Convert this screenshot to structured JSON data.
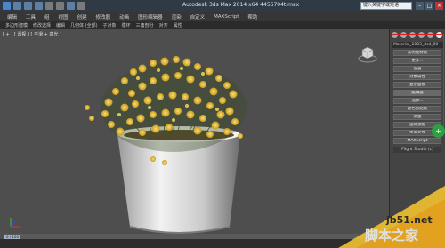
{
  "window": {
    "title": "Autodesk 3ds Max 2014 x64    4456704t.max",
    "search_placeholder": "键入关键字或短语"
  },
  "menubar": {
    "items": [
      "编辑",
      "工具",
      "组",
      "视图",
      "创建",
      "修改器",
      "动画",
      "图形编辑器",
      "渲染",
      "自定义",
      "MAXScript",
      "帮助"
    ]
  },
  "ribbon": {
    "tabs": [
      "建模",
      "自由形式",
      "选择",
      "对象绘制",
      "填充"
    ],
    "subtabs": [
      "多边形建模",
      "修改选择",
      "编辑",
      "几何体 (全部)",
      "子对象",
      "循环",
      "三角剖分",
      "对齐",
      "属性"
    ]
  },
  "viewport": {
    "label": "[ + ] [ 透视 ] [ 平滑 + 高光 ]"
  },
  "command_panel": {
    "modifier_name": "Material_1003_dsd_00",
    "buttons": [
      "实例化材质",
      "更多...",
      "设置",
      "对象属性",
      "显示面板",
      "编辑器",
      "选择...",
      "颜色剪贴板",
      "测量",
      "运动捕捉",
      "重置变换",
      "MAXScript"
    ],
    "plugin_label": "Flight Studio (c)"
  },
  "timeline": {
    "frame_label": "0 / 100"
  },
  "watermark": {
    "url": "jb51.net",
    "name": "脚本之家"
  },
  "colors": {
    "highlight": "#e02020",
    "viewport_bg": "#4e4e4e"
  }
}
